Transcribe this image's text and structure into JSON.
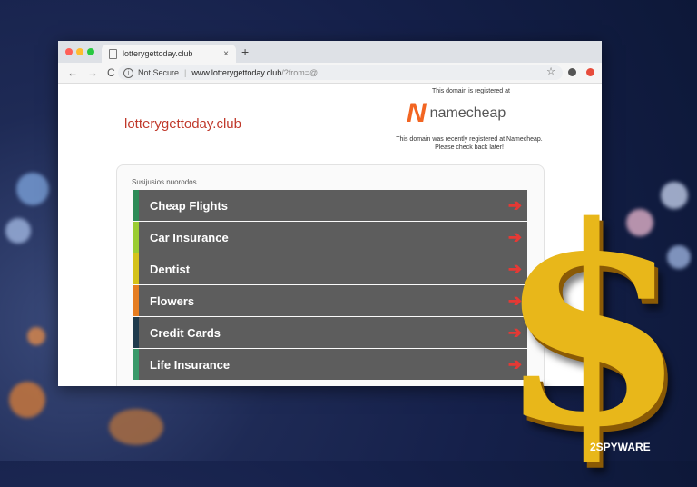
{
  "browser": {
    "tab_title": "lotterygettoday.club",
    "tab_close": "×",
    "new_tab": "+",
    "nav_back": "←",
    "nav_forward": "→",
    "nav_reload": "C",
    "not_secure": "Not Secure",
    "url_host": "www.lotterygettoday.club",
    "url_path": "/?from=@",
    "star": "☆"
  },
  "page": {
    "site_name": "lotterygettoday.club",
    "registered_at": "This domain is registered at",
    "registrar_logo_mark": "N",
    "registrar_name": "namecheap",
    "registered_msg_line1": "This domain was recently registered at Namecheap.",
    "registered_msg_line2": "Please check back later!",
    "links_title": "Susijusios nuorodos",
    "links": [
      {
        "label": "Cheap Flights",
        "color": "#2e8b57"
      },
      {
        "label": "Car Insurance",
        "color": "#9acd32"
      },
      {
        "label": "Dentist",
        "color": "#d4c21a"
      },
      {
        "label": "Flowers",
        "color": "#e67e22"
      },
      {
        "label": "Credit Cards",
        "color": "#1f3b4d"
      },
      {
        "label": "Life Insurance",
        "color": "#3a9a6a"
      }
    ],
    "arrow": "➔"
  },
  "overlay": {
    "dollar": "$",
    "watermark": "2SPYWARE"
  }
}
